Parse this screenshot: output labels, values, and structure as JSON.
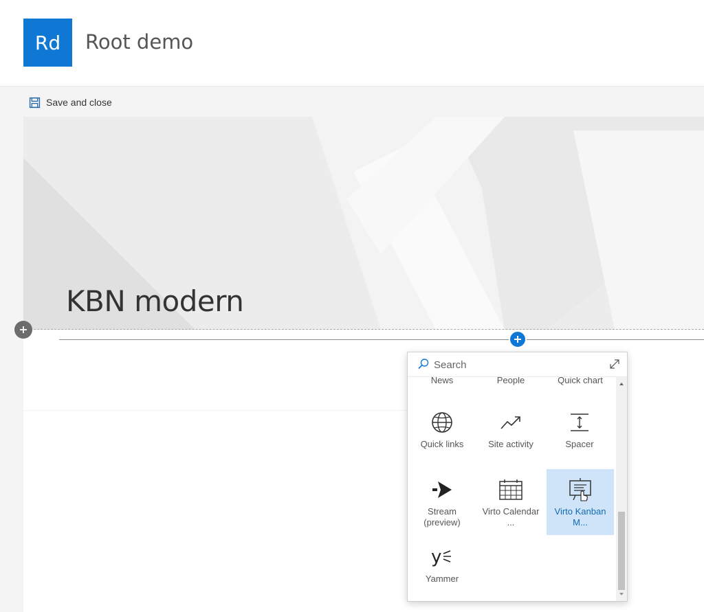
{
  "site": {
    "logo_text": "Rd",
    "title": "Root demo",
    "brand_color": "#0f78d4"
  },
  "command_bar": {
    "save_close_label": "Save and close",
    "save_icon": "save-icon"
  },
  "page": {
    "heading": "KBN modern"
  },
  "toolbox": {
    "search_placeholder": "Search",
    "partial_row": [
      "News",
      "People",
      "Quick chart"
    ],
    "items": [
      {
        "label": "Quick links",
        "icon": "globe-icon"
      },
      {
        "label": "Site activity",
        "icon": "trend-icon"
      },
      {
        "label": "Spacer",
        "icon": "spacer-icon"
      },
      {
        "label": "Stream (preview)",
        "icon": "stream-icon"
      },
      {
        "label": "Virto Calendar ...",
        "icon": "calendar-icon"
      },
      {
        "label": "Virto Kanban M...",
        "icon": "kanban-icon",
        "selected": true
      },
      {
        "label": "Yammer",
        "icon": "yammer-icon"
      }
    ]
  }
}
